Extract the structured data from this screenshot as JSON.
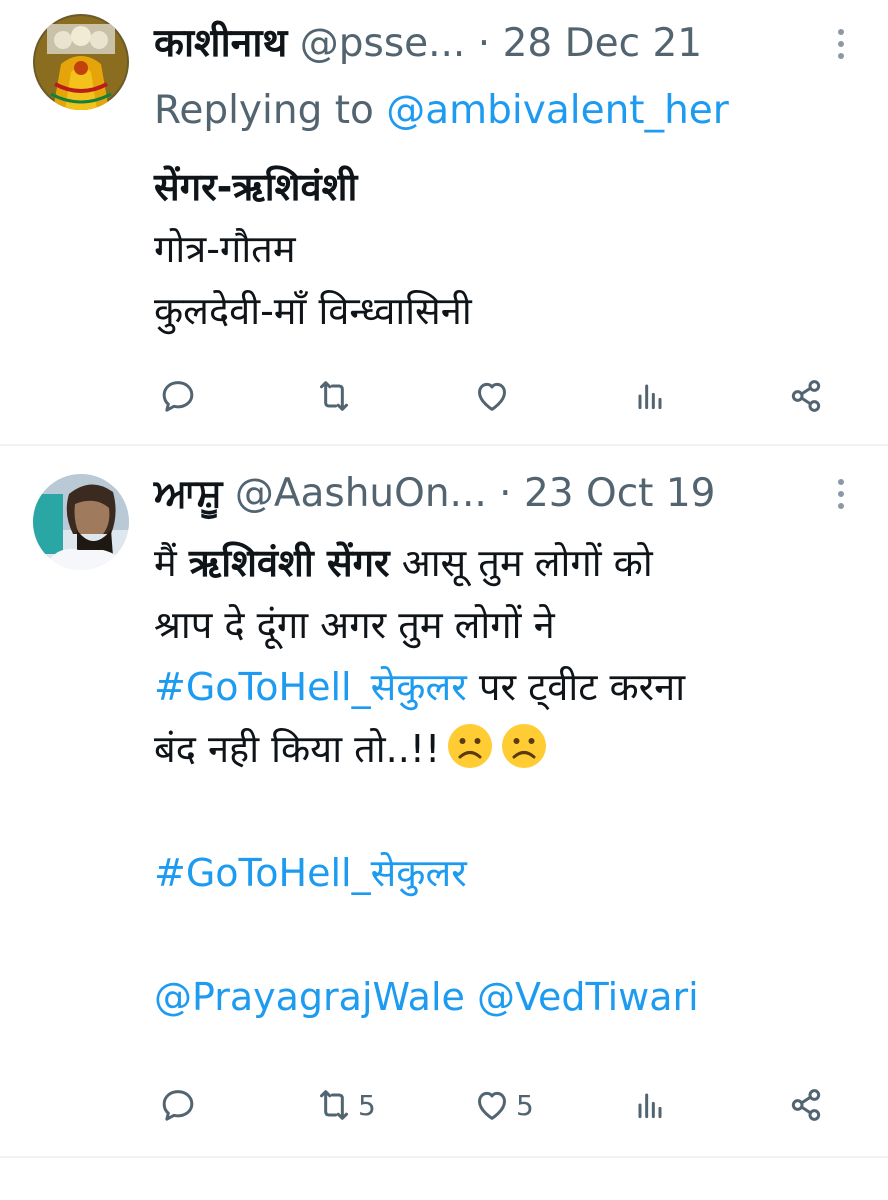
{
  "tweets": [
    {
      "name": "काशीनाथ",
      "handle": "@psse...",
      "separator": "·",
      "date": "28 Dec 21",
      "replying_prefix": "Replying to",
      "replying_to": "@ambivalent_her",
      "title": "सेंगर-ऋशिवंशी",
      "lines": [
        "गोत्र-गौतम",
        "कुलदेवी-माँ विन्ध्वासिनी"
      ],
      "avatar_icon": "deity-idol-avatar",
      "actions": {
        "reply": "",
        "retweet": "",
        "like": "",
        "views": "",
        "share": ""
      }
    },
    {
      "name": "ਆਸ਼ੂ",
      "handle": "@AashuOn...",
      "separator": "·",
      "date": "23 Oct 19",
      "line1_prefix": "मैं",
      "line1_bold": "ऋशिवंशी सेंगर",
      "line1_suffix": "आसू तुम लोगों को",
      "line2": "श्राप दे दूंगा अगर तुम लोगों ने",
      "hashtag1": "#GoToHell_सेकुलर",
      "line3_suffix": "पर ट्वीट करना",
      "line4": "बंद नही किया तो..!!",
      "emojis": [
        "frowning-face",
        "frowning-face"
      ],
      "hashtag2": "#GoToHell_सेकुलर",
      "mention1": "@PrayagrajWale",
      "mention2": "@VedTiwari",
      "avatar_icon": "bearded-man-avatar",
      "actions": {
        "reply": "",
        "retweet": "5",
        "like": "5",
        "views": "",
        "share": ""
      }
    }
  ],
  "colors": {
    "link": "#1d9bf0",
    "secondary": "#536471",
    "text": "#0f1419",
    "divider": "#eff3f4"
  }
}
